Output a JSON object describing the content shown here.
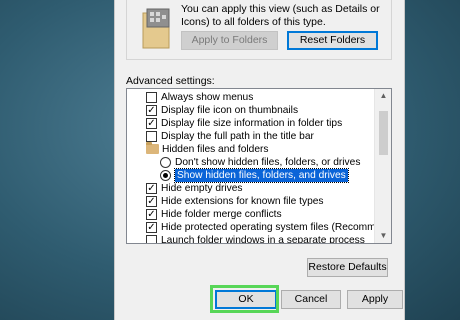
{
  "folder_views": {
    "description": "You can apply this view (such as Details or Icons) to all folders of this type.",
    "apply_label": "Apply to Folders",
    "reset_label": "Reset Folders"
  },
  "advanced": {
    "label": "Advanced settings:",
    "items": [
      {
        "type": "checkbox",
        "checked": false,
        "label": "Always show menus"
      },
      {
        "type": "checkbox",
        "checked": true,
        "label": "Display file icon on thumbnails"
      },
      {
        "type": "checkbox",
        "checked": true,
        "label": "Display file size information in folder tips"
      },
      {
        "type": "checkbox",
        "checked": false,
        "label": "Display the full path in the title bar"
      },
      {
        "type": "folder",
        "label": "Hidden files and folders"
      },
      {
        "type": "radio",
        "checked": false,
        "label": "Don't show hidden files, folders, or drives"
      },
      {
        "type": "radio",
        "checked": true,
        "selected": true,
        "label": "Show hidden files, folders, and drives"
      },
      {
        "type": "checkbox",
        "checked": true,
        "label": "Hide empty drives"
      },
      {
        "type": "checkbox",
        "checked": true,
        "label": "Hide extensions for known file types"
      },
      {
        "type": "checkbox",
        "checked": true,
        "label": "Hide folder merge conflicts"
      },
      {
        "type": "checkbox",
        "checked": true,
        "label": "Hide protected operating system files (Recommended)"
      },
      {
        "type": "checkbox",
        "checked": false,
        "label": "Launch folder windows in a separate process"
      }
    ],
    "restore_label": "Restore Defaults"
  },
  "footer": {
    "ok_label": "OK",
    "cancel_label": "Cancel",
    "apply_label": "Apply"
  },
  "colors": {
    "highlight": "#57d657",
    "selection": "#0a64d8",
    "focus": "#0078d7"
  }
}
